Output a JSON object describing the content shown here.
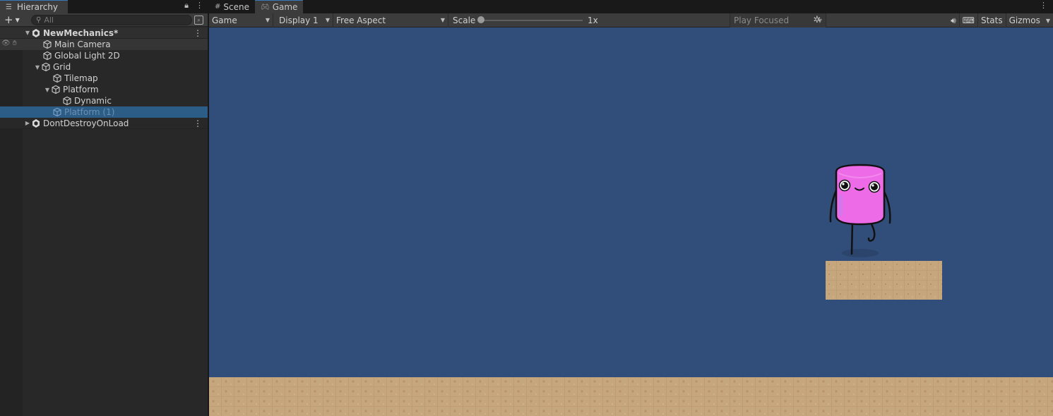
{
  "hierarchy": {
    "tab_title": "Hierarchy",
    "search_placeholder": "All",
    "add_label": "+",
    "items": [
      {
        "label": "NewMechanics*",
        "kind": "scene"
      },
      {
        "label": "Main Camera",
        "kind": "object"
      },
      {
        "label": "Global Light 2D",
        "kind": "object"
      },
      {
        "label": "Grid",
        "kind": "object"
      },
      {
        "label": "Tilemap",
        "kind": "object"
      },
      {
        "label": "Platform",
        "kind": "object"
      },
      {
        "label": "Dynamic",
        "kind": "object"
      },
      {
        "label": "Platform (1)",
        "kind": "object"
      },
      {
        "label": "DontDestroyOnLoad",
        "kind": "scene"
      }
    ]
  },
  "game": {
    "tabs": [
      {
        "label": "Scene",
        "icon": "grid-icon"
      },
      {
        "label": "Game",
        "icon": "gamepad-icon"
      }
    ],
    "toolbar": {
      "view_select": "Game",
      "display_select": "Display 1",
      "aspect_select": "Free Aspect",
      "scale_label": "Scale",
      "scale_value": "1x",
      "play_mode": "Play Focused",
      "stats_label": "Stats",
      "gizmos_label": "Gizmos"
    }
  },
  "colors": {
    "sky": "#314d79",
    "ground": "#c6a67c",
    "character": "#ee6be8",
    "selection": "#2c5d87",
    "accent": "#3a79bb"
  }
}
